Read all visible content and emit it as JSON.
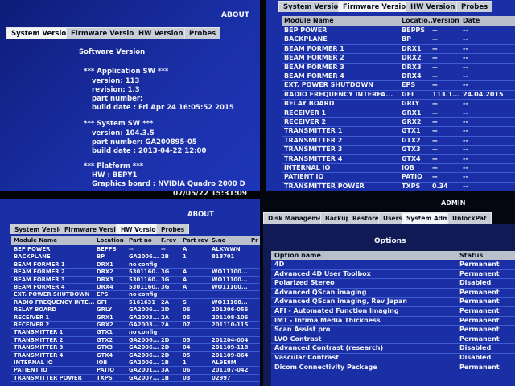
{
  "q1": {
    "title": "ABOUT",
    "tabs": [
      "System Version",
      "Firmware Version",
      "HW Version",
      "Probes"
    ],
    "heading": "Software Version",
    "lines": [
      "*** Application SW ***",
      "version: 113",
      "revision: 1.3",
      "part number:",
      "build date : Fri Apr 24 16:05:52 2015",
      "*** System SW ***",
      "version: 104.3.5",
      "part number: GA200895-05",
      "build date : 2013-04-22 12:00",
      "*** Platform ***",
      "HW : BEPY1",
      "Graphics board : NVIDIA Quadro 2000 D"
    ],
    "timestamp": "07/05/22 15:31:09"
  },
  "q2": {
    "tabs": [
      "System Version",
      "Firmware Version",
      "HW Version",
      "Probes"
    ],
    "columns": [
      "Module Name",
      "Locatio...",
      "Version",
      "Date"
    ],
    "rows": [
      [
        "BEP POWER",
        "BEPPS",
        "--",
        "--"
      ],
      [
        "BACKPLANE",
        "BP",
        "--",
        "--"
      ],
      [
        "BEAM FORMER 1",
        "DRX1",
        "--",
        "--"
      ],
      [
        "BEAM FORMER 2",
        "DRX2",
        "--",
        "--"
      ],
      [
        "BEAM FORMER 3",
        "DRX3",
        "--",
        "--"
      ],
      [
        "BEAM FORMER 4",
        "DRX4",
        "--",
        "--"
      ],
      [
        "EXT. POWER SHUTDOWN",
        "EPS",
        "--",
        "--"
      ],
      [
        "RADIO FREQUENCY INTERFA...",
        "GFI",
        "113.1....",
        "24.04.2015"
      ],
      [
        "RELAY BOARD",
        "GRLY",
        "--",
        "--"
      ],
      [
        "RECEIVER 1",
        "GRX1",
        "--",
        "--"
      ],
      [
        "RECEIVER 2",
        "GRX2",
        "--",
        "--"
      ],
      [
        "TRANSMITTER 1",
        "GTX1",
        "--",
        "--"
      ],
      [
        "TRANSMITTER 2",
        "GTX2",
        "--",
        "--"
      ],
      [
        "TRANSMITTER 3",
        "GTX3",
        "--",
        "--"
      ],
      [
        "TRANSMITTER 4",
        "GTX4",
        "--",
        "--"
      ],
      [
        "INTERNAL IO",
        "IOB",
        "--",
        "--"
      ],
      [
        "PATIENT IO",
        "PATIO",
        "--",
        "--"
      ],
      [
        "TRANSMITTER POWER",
        "TXPS",
        "0.34",
        "--"
      ]
    ]
  },
  "q3": {
    "title": "ABOUT",
    "tabs": [
      "System Version",
      "Firmware Version",
      "HW Version",
      "Probes"
    ],
    "columns": [
      "Module Name",
      "Location",
      "Part no",
      "F.rev",
      "Part rev",
      "S.no",
      "Pr"
    ],
    "rows": [
      [
        "BEP POWER",
        "BEPPS",
        "--",
        "--",
        "A",
        "ALKWWN",
        ""
      ],
      [
        "BACKPLANE",
        "BP",
        "GA2006...",
        "2B",
        "1",
        "818701",
        ""
      ],
      [
        "BEAM FORMER 1",
        "DRX1",
        "no config",
        "",
        "",
        "",
        ""
      ],
      [
        "BEAM FORMER 2",
        "DRX2",
        "5301160...",
        "3G",
        "A",
        "WO11100...",
        ""
      ],
      [
        "BEAM FORMER 3",
        "DRX3",
        "5301160...",
        "3G",
        "A",
        "WO11100...",
        ""
      ],
      [
        "BEAM FORMER 4",
        "DRX4",
        "5301160...",
        "3G",
        "A",
        "WO11100...",
        ""
      ],
      [
        "EXT. POWER SHUTDOWN",
        "EPS",
        "no config",
        "",
        "",
        "",
        ""
      ],
      [
        "RADIO FREQUENCY INTE...",
        "GFI",
        "5161631",
        "2A",
        "S",
        "WO11108...",
        ""
      ],
      [
        "RELAY BOARD",
        "GRLY",
        "GA2006...",
        "2D",
        "06",
        "201306-056",
        ""
      ],
      [
        "RECEIVER 1",
        "GRX1",
        "GA2003...",
        "2A",
        "05",
        "201108-106",
        ""
      ],
      [
        "RECEIVER 2",
        "GRX2",
        "GA2003...",
        "2A",
        "07",
        "201110-115",
        ""
      ],
      [
        "TRANSMITTER 1",
        "GTX1",
        "no config",
        "",
        "",
        "",
        ""
      ],
      [
        "TRANSMITTER 2",
        "GTX2",
        "GA2006...",
        "2D",
        "05",
        "201204-004",
        ""
      ],
      [
        "TRANSMITTER 3",
        "GTX3",
        "GA2006...",
        "2D",
        "04",
        "201109-118",
        ""
      ],
      [
        "TRANSMITTER 4",
        "GTX4",
        "GA2006...",
        "2D",
        "05",
        "201109-064",
        ""
      ],
      [
        "INTERNAL IO",
        "IOB",
        "GA2006...",
        "1B",
        "1",
        "AL9E8M",
        ""
      ],
      [
        "PATIENT IO",
        "PATIO",
        "GA2001...",
        "3A",
        "06",
        "201107-042",
        ""
      ],
      [
        "TRANSMITTER POWER",
        "TXPS",
        "GA2007...",
        "1B",
        "03",
        "02997",
        ""
      ]
    ]
  },
  "q4": {
    "title": "ADMIN",
    "tabs": [
      "Disk Management",
      "Backup",
      "Restore",
      "Users",
      "System Admin",
      "UnlockPat"
    ],
    "heading": "Options",
    "columns": [
      "Option name",
      "Status"
    ],
    "rows": [
      [
        "4D",
        "Permanent"
      ],
      [
        "Advanced 4D User Toolbox",
        "Permanent"
      ],
      [
        "Polarized Stereo",
        "Disabled"
      ],
      [
        "Advanced QScan imaging",
        "Permanent"
      ],
      [
        "Advanced QScan imaging, Rev Japan",
        "Permanent"
      ],
      [
        "AFI - Automated Function Imaging",
        "Permanent"
      ],
      [
        "IMT - Intima Media Thickness",
        "Permanent"
      ],
      [
        "Scan Assist pro",
        "Permanent"
      ],
      [
        "LVO Contrast",
        "Permanent"
      ],
      [
        "Advanced Contrast (research)",
        "Disabled"
      ],
      [
        "Vascular Contrast",
        "Disabled"
      ],
      [
        "Dicom Connectivity Package",
        "Permanent"
      ]
    ]
  },
  "colors": {
    "screen_blue": "#1a2fa6",
    "tab_gray": "#c9ced6",
    "row_line": "#3e5bd0",
    "header_gray": "#b9bfcb"
  }
}
